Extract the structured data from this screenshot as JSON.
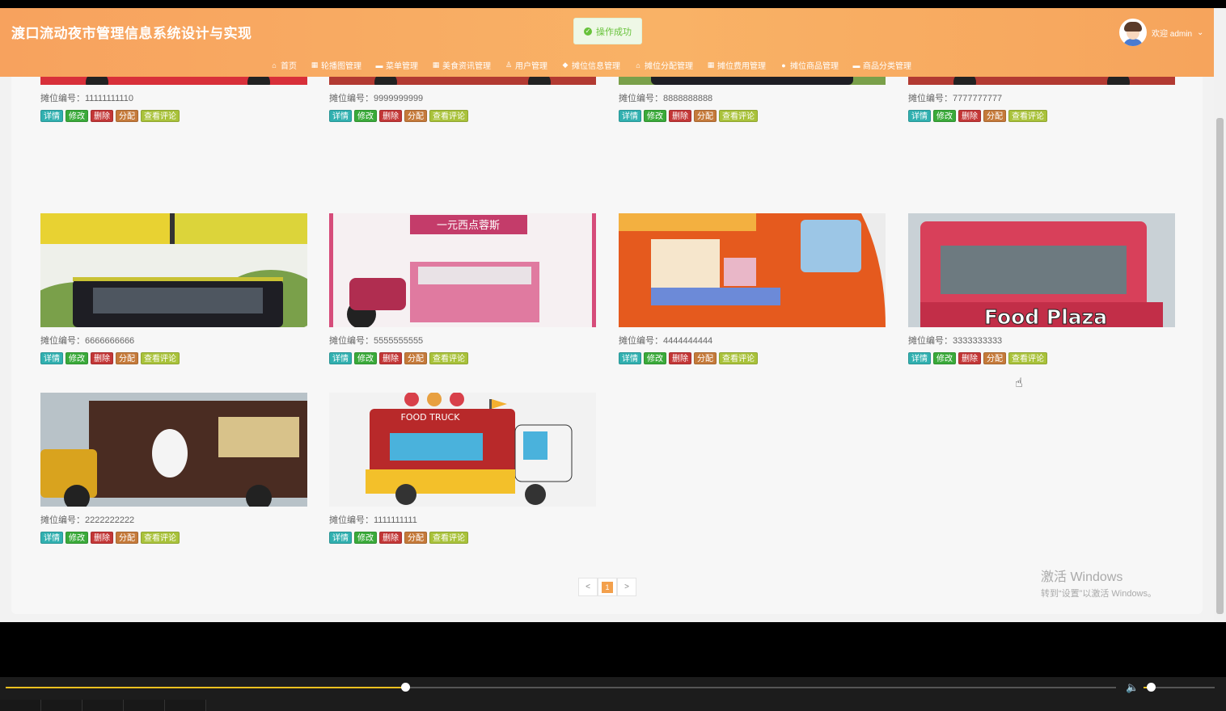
{
  "app": {
    "title": "渡口流动夜市管理信息系统设计与实现"
  },
  "toast": {
    "message": "操作成功"
  },
  "user": {
    "greeting": "欢迎 admin"
  },
  "nav": [
    {
      "label": "首页",
      "icon": "home-icon"
    },
    {
      "label": "轮播图管理",
      "icon": "grid-icon"
    },
    {
      "label": "菜单管理",
      "icon": "folder-icon"
    },
    {
      "label": "美食资讯管理",
      "icon": "grid-icon"
    },
    {
      "label": "用户管理",
      "icon": "user-icon"
    },
    {
      "label": "摊位信息管理",
      "icon": "tag-icon"
    },
    {
      "label": "摊位分配管理",
      "icon": "bank-icon"
    },
    {
      "label": "摊位费用管理",
      "icon": "grid-icon"
    },
    {
      "label": "摊位商品管理",
      "icon": "gear-icon"
    },
    {
      "label": "商品分类管理",
      "icon": "folder-icon"
    }
  ],
  "stall_prefix": "摊位编号：",
  "buttons": {
    "detail": "详情",
    "edit": "修改",
    "delete": "删除",
    "assign": "分配",
    "review": "查看评论"
  },
  "stalls": [
    {
      "code": "11111111110",
      "image": "white-red-van"
    },
    {
      "code": "9999999999",
      "image": "red-bus"
    },
    {
      "code": "8888888888",
      "image": "black-bus"
    },
    {
      "code": "7777777777",
      "image": "red-bus"
    },
    {
      "code": "6666666666",
      "image": "black-bus"
    },
    {
      "code": "5555555555",
      "image": "pink-tricycle-cart"
    },
    {
      "code": "4444444444",
      "image": "orange-food-truck"
    },
    {
      "code": "3333333333",
      "image": "food-plaza-kiosk"
    },
    {
      "code": "2222222222",
      "image": "snowbear-truck"
    },
    {
      "code": "1111111111",
      "image": "food-truck-cartoon"
    }
  ],
  "food_plaza_text": "Food Plaza",
  "food_truck_text": "FOOD TRUCK",
  "cart_sign_text": "一元西点蓉斯",
  "pager": {
    "prev": "<",
    "current": "1",
    "next": ">"
  },
  "watermark": {
    "line1": "激活 Windows",
    "line2": "转到“设置”以激活 Windows。"
  },
  "colors": {
    "header": "#f7a25e",
    "detail": "#31b0b0",
    "edit": "#3aaa3a",
    "delete": "#c33737",
    "assign": "#c57a3a",
    "review": "#a9c23a"
  },
  "player": {
    "progress": 0.36,
    "volume": 0.1
  }
}
